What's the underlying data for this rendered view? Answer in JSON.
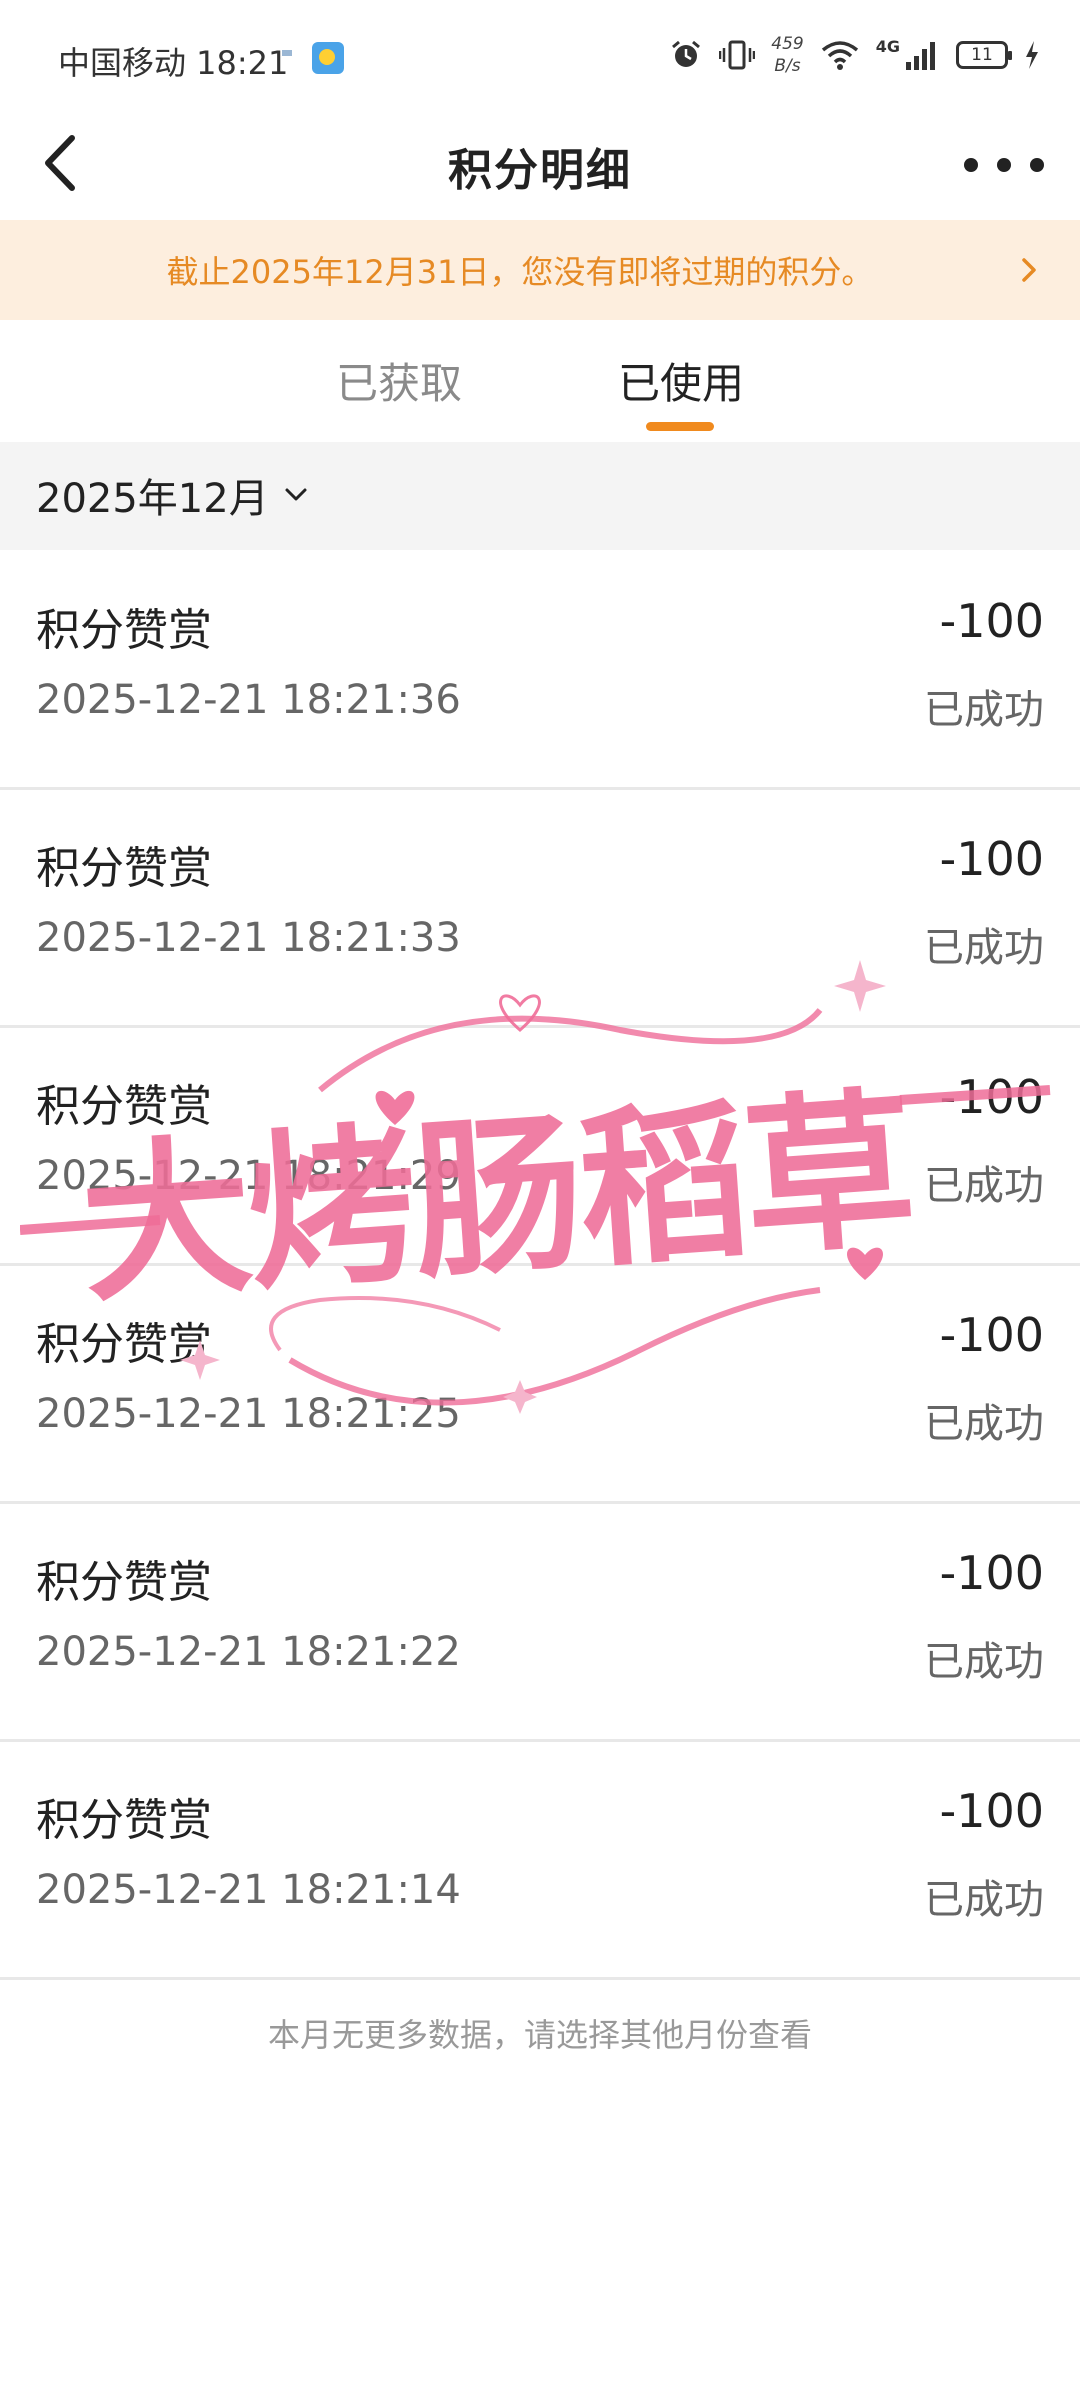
{
  "status_bar": {
    "carrier_time": "中国移动 18:21",
    "speed_value": "459",
    "speed_unit": "B/s",
    "network": "4G",
    "battery": "11"
  },
  "header": {
    "title": "积分明细"
  },
  "notice": {
    "text": "截止2025年12月31日，您没有即将过期的积分。"
  },
  "tabs": {
    "earned": "已获取",
    "used": "已使用",
    "active": "used"
  },
  "month_filter": {
    "value": "2025年12月"
  },
  "records": [
    {
      "title": "积分赞赏",
      "time": "2025-12-21 18:21:36",
      "amount": "-100",
      "status": "已成功"
    },
    {
      "title": "积分赞赏",
      "time": "2025-12-21 18:21:33",
      "amount": "-100",
      "status": "已成功"
    },
    {
      "title": "积分赞赏",
      "time": "2025-12-21 18:21:29",
      "amount": "-100",
      "status": "已成功"
    },
    {
      "title": "积分赞赏",
      "time": "2025-12-21 18:21:25",
      "amount": "-100",
      "status": "已成功"
    },
    {
      "title": "积分赞赏",
      "time": "2025-12-21 18:21:22",
      "amount": "-100",
      "status": "已成功"
    },
    {
      "title": "积分赞赏",
      "time": "2025-12-21 18:21:14",
      "amount": "-100",
      "status": "已成功"
    }
  ],
  "footer": {
    "text": "本月无更多数据，请选择其他月份查看"
  },
  "watermark": {
    "text": "大烤肠稻草"
  },
  "colors": {
    "accent": "#f08a1e",
    "notice_bg": "#fdeede",
    "notice_text": "#e68a24",
    "watermark": "#ef6d98"
  },
  "icons": [
    "back-icon",
    "more-icon",
    "chevron-right-icon",
    "chevron-down-icon",
    "alarm-icon",
    "vibrate-icon",
    "wifi-icon",
    "signal-icon",
    "battery-icon",
    "charging-icon",
    "weather-icon"
  ]
}
